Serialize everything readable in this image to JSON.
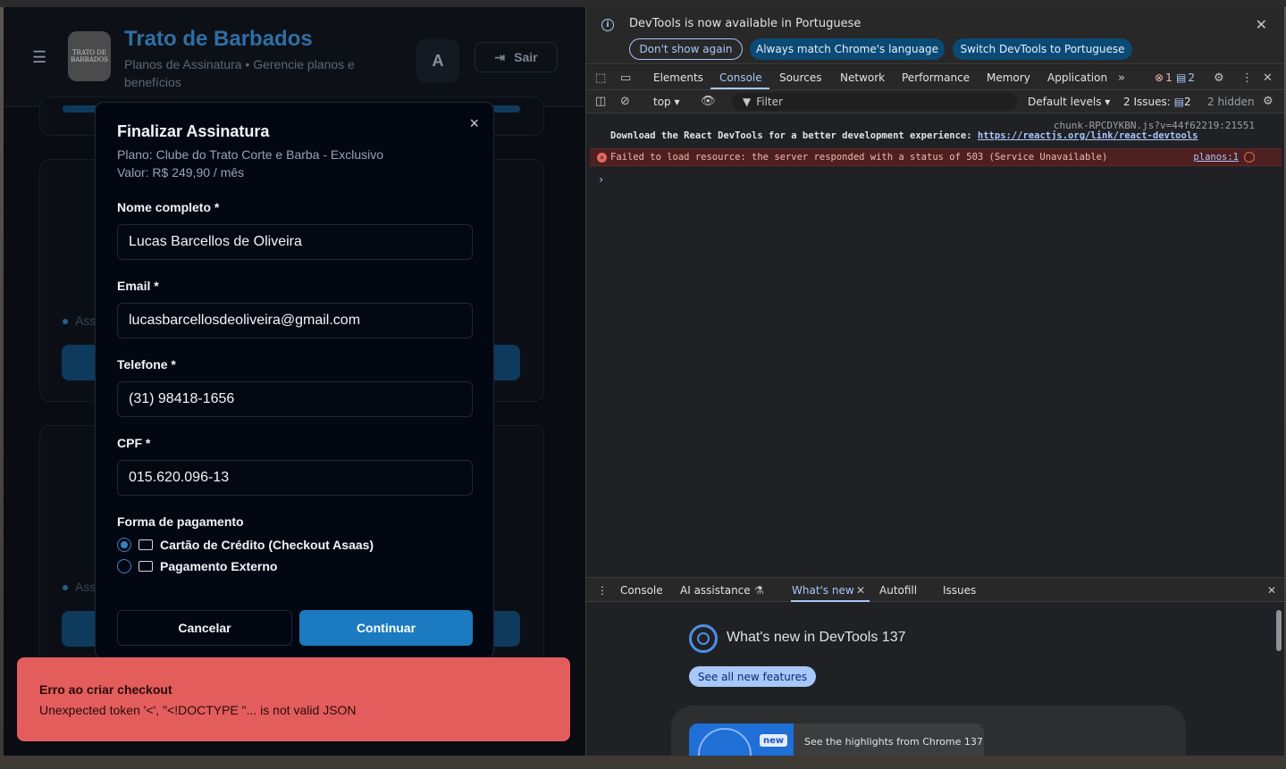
{
  "app": {
    "brand_title": "Trato de Barbados",
    "brand_subtitle": "Planos de Assinatura • Gerencie planos e benefícios",
    "logo_text": "TRATO DE BARBADOS",
    "avatar_initial": "A",
    "logout_label": "Sair",
    "bg_card_text_1": "Ass",
    "bg_card_text_2": "Ass"
  },
  "modal": {
    "title": "Finalizar Assinatura",
    "plan": "Plano: Clube do Trato Corte e Barba - Exclusivo",
    "value": "Valor: R$ 249,90 / mês",
    "fields": [
      {
        "label": "Nome completo *",
        "value": "Lucas Barcellos de Oliveira"
      },
      {
        "label": "Email *",
        "value": "lucasbarcellosdeoliveira@gmail.com"
      },
      {
        "label": "Telefone *",
        "value": "(31) 98418-1656"
      },
      {
        "label": "CPF *",
        "value": "015.620.096-13"
      }
    ],
    "payment_label": "Forma de pagamento",
    "payment_options": [
      {
        "label": "Cartão de Crédito (Checkout Asaas)",
        "selected": true
      },
      {
        "label": "Pagamento Externo",
        "selected": false
      }
    ],
    "cancel_label": "Cancelar",
    "continue_label": "Continuar",
    "close_icon": "×"
  },
  "toast": {
    "title": "Erro ao criar checkout",
    "message": "Unexpected token '<', \"<!DOCTYPE \"... is not valid JSON"
  },
  "devtools": {
    "infobar": {
      "text": "DevTools is now available in Portuguese",
      "dont_show": "Don't show again",
      "always_match": "Always match Chrome's language",
      "switch": "Switch DevTools to Portuguese"
    },
    "tabs": [
      "Elements",
      "Console",
      "Sources",
      "Network",
      "Performance",
      "Memory",
      "Application"
    ],
    "active_tab": "Console",
    "error_count": "1",
    "message_count": "2",
    "toolbar": {
      "context": "top",
      "filter_placeholder": "Filter",
      "levels": "Default levels",
      "issues_label": "2 Issues:",
      "issues_count": "2",
      "hidden": "2 hidden"
    },
    "console": {
      "source_link": "chunk-RPCDYKBN.js?v=44f62219:21551",
      "log_text": "Download the React DevTools for a better development experience: ",
      "log_link": "https://reactjs.org/link/react-devtools",
      "error_text": "Failed to load resource: the server responded with a status of 503 (Service Unavailable)",
      "error_link": "planos:1",
      "prompt": "›"
    },
    "drawer_tabs": [
      "Console",
      "AI assistance",
      "What's new",
      "Autofill",
      "Issues"
    ],
    "whats_new": {
      "title": "What's new in DevTools 137",
      "button": "See all new features",
      "badge": "new",
      "card_text": "See the highlights from Chrome 137"
    }
  },
  "colors": {
    "accent": "#1b7ac0",
    "toast_bg": "#e35d5d",
    "devtools_accent": "#a8c7fa"
  }
}
